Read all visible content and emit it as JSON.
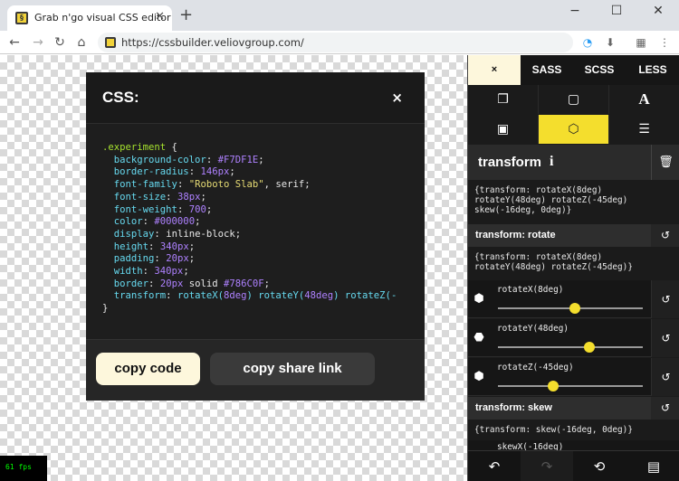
{
  "browser": {
    "tab_title": "Grab n'go visual CSS editor",
    "url": "https://cssbuilder.veliovgroup.com/"
  },
  "fps_label": "61   fps",
  "modal": {
    "title": "CSS:",
    "close": "×",
    "code": {
      "selector": ".experiment",
      "open": "{",
      "close": "}",
      "lines": [
        {
          "prop": "background-color",
          "val": "#F7DF1E",
          "kind": "num"
        },
        {
          "prop": "border-radius",
          "val": "146px",
          "kind": "num"
        },
        {
          "prop": "font-family",
          "val": "\"Roboto Slab\"",
          "rest": ", serif;",
          "kind": "str"
        },
        {
          "prop": "font-size",
          "val": "38px",
          "kind": "num"
        },
        {
          "prop": "font-weight",
          "val": "700",
          "kind": "num"
        },
        {
          "prop": "color",
          "val": "#000000",
          "kind": "num"
        },
        {
          "prop": "display",
          "val": "inline-block",
          "kind": "plain"
        },
        {
          "prop": "height",
          "val": "340px",
          "kind": "num"
        },
        {
          "prop": "padding",
          "val": "20px",
          "kind": "num"
        },
        {
          "prop": "width",
          "val": "340px",
          "kind": "num"
        },
        {
          "prop": "border",
          "val": "20px",
          "rest": " solid ",
          "val2": "#786C0F",
          "kind": "num"
        },
        {
          "prop": "transform",
          "val": "rotateX(8deg) rotateY(48deg) rotateZ(-",
          "kind": "transform"
        }
      ]
    },
    "copy_code": "copy code",
    "copy_share_link": "copy share link"
  },
  "sidebar": {
    "tabs": [
      "×",
      "SASS",
      "SCSS",
      "LESS"
    ],
    "section_title": "transform",
    "section_snippet": "{transform: rotateX(8deg)\nrotateY(48deg) rotateZ(-45deg)\nskew(-16deg, 0deg)}",
    "rotate": {
      "title": "transform: rotate",
      "snippet": "{transform: rotateX(8deg)\nrotateY(48deg) rotateZ(-45deg)}",
      "sliders": [
        {
          "label": "rotateX(8deg)",
          "level": 0.53
        },
        {
          "label": "rotateY(48deg)",
          "level": 0.63
        },
        {
          "label": "rotateZ(-45deg)",
          "level": 0.38
        }
      ]
    },
    "skew": {
      "title": "transform: skew",
      "snippet": "{transform: skew(-16deg, 0deg)}",
      "partial_label": "skewX(-16deg)"
    }
  },
  "colors": {
    "accent": "#F4DE2D",
    "cream": "#FDF7DC",
    "panel": "#1E1E1E"
  }
}
